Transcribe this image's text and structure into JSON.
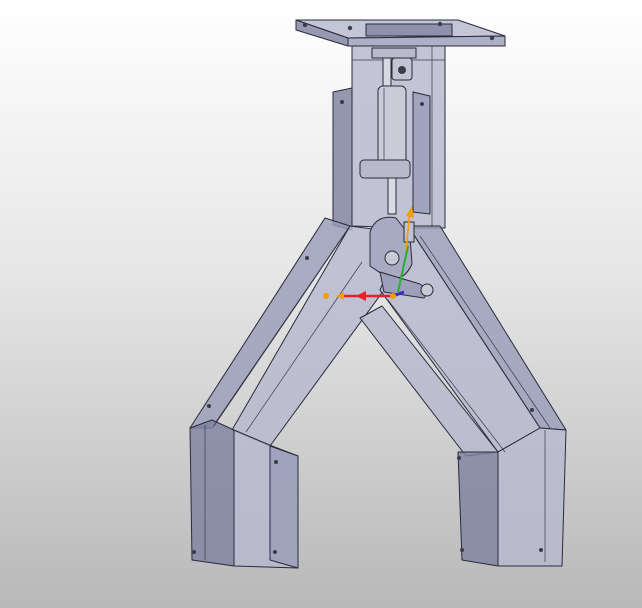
{
  "viewport": {
    "background_top": "#ffffff",
    "background_bottom": "#b8b8b8"
  },
  "model": {
    "part_color": "#9a9db8",
    "part_face_color": "#b7b9d0",
    "part_dark_color": "#7f83a0",
    "edge_color": "#2a2a3a",
    "cylinder_color": "#c9cbd6"
  },
  "triad": {
    "x_axis_color": "#e8202a",
    "y_axis_color": "#22b030",
    "z_axis_color": "#3a2acb",
    "handle_color": "#f0a000"
  }
}
